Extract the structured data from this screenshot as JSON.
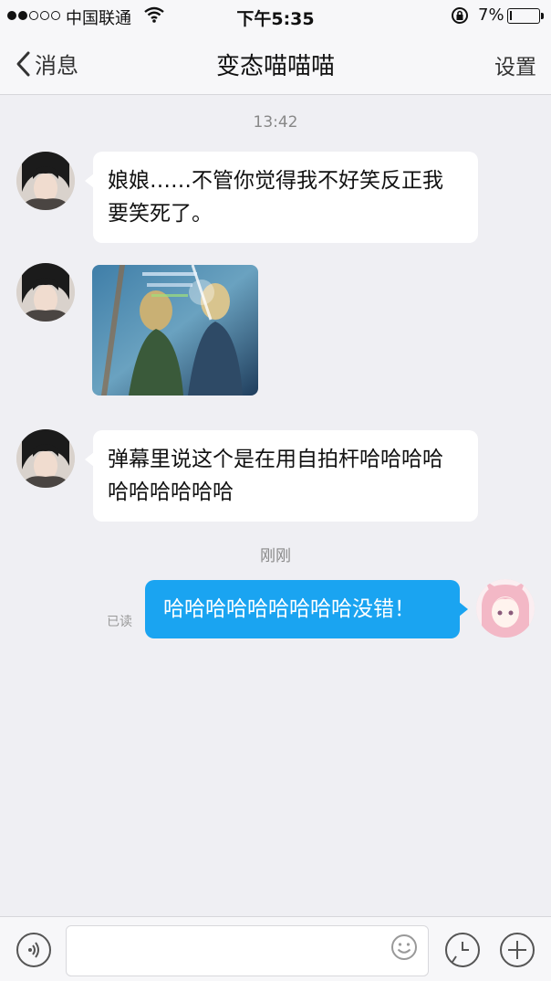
{
  "status_bar": {
    "carrier": "中国联通",
    "time": "下午5:35",
    "battery_percent": "7%",
    "battery_level": 0.07
  },
  "nav": {
    "back_label": "消息",
    "title": "变态喵喵喵",
    "settings_label": "设置"
  },
  "chat": {
    "timestamp_1": "13:42",
    "msg_1": "娘娘……不管你觉得我不好笑反正我要笑死了。",
    "msg_3": "弹幕里说这个是在用自拍杆哈哈哈哈哈哈哈哈哈哈",
    "timestamp_2": "刚刚",
    "msg_out": "哈哈哈哈哈哈哈哈哈没错！",
    "read_label": "已读"
  },
  "icons": {
    "back": "chevron-left-icon",
    "voice": "voice-icon",
    "emoji": "emoji-icon",
    "clock": "clock-icon",
    "plus": "plus-icon"
  },
  "colors": {
    "outgoing_bubble": "#1aa4f1",
    "incoming_bubble": "#ffffff",
    "background": "#efeff3"
  }
}
